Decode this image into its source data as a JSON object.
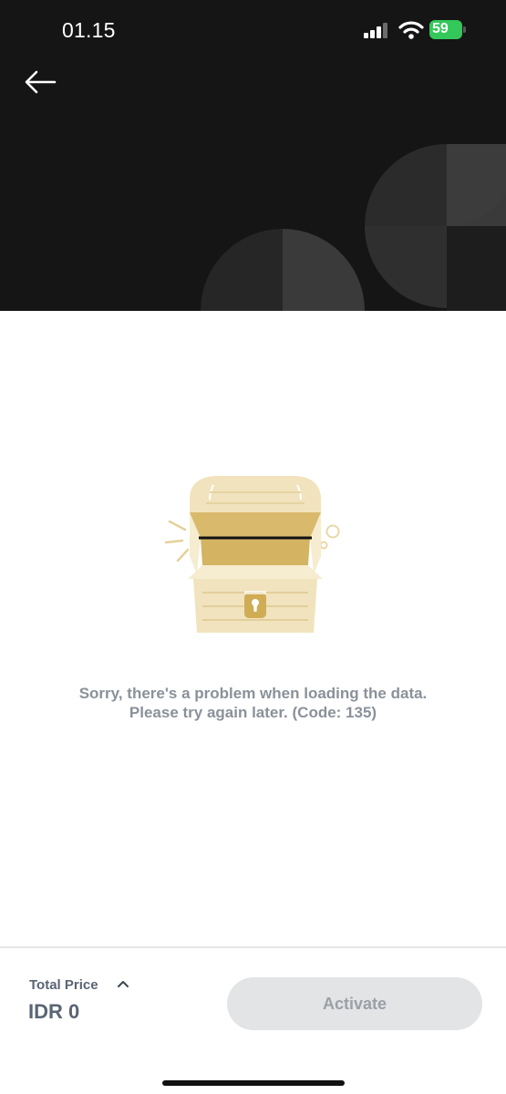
{
  "status_bar": {
    "time": "01.15",
    "battery": "59"
  },
  "icons": {
    "back": "arrow-left-icon",
    "signal": "cellular-signal-icon",
    "wifi": "wifi-icon",
    "battery": "battery-icon",
    "chevron": "chevron-up-icon"
  },
  "empty_state": {
    "illustration": "treasure-chest-illustration",
    "message": "Sorry, there's a problem when loading the data. Please try again later. (Code: 135)"
  },
  "footer": {
    "total_label": "Total Price",
    "total_value": "IDR 0",
    "activate_label": "Activate"
  },
  "colors": {
    "header_bg": "#151515",
    "gold": "#d4b66a",
    "gold_light": "#f1e4c0",
    "text_muted": "#8a9199",
    "battery_green": "#34c759"
  }
}
